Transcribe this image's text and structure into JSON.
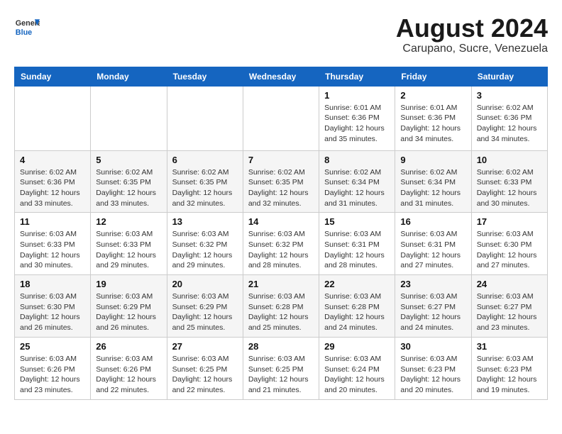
{
  "header": {
    "logo_general": "General",
    "logo_blue": "Blue",
    "main_title": "August 2024",
    "subtitle": "Carupano, Sucre, Venezuela"
  },
  "days_of_week": [
    "Sunday",
    "Monday",
    "Tuesday",
    "Wednesday",
    "Thursday",
    "Friday",
    "Saturday"
  ],
  "weeks": [
    {
      "cells": [
        {
          "day": "",
          "info": ""
        },
        {
          "day": "",
          "info": ""
        },
        {
          "day": "",
          "info": ""
        },
        {
          "day": "",
          "info": ""
        },
        {
          "day": "1",
          "info": "Sunrise: 6:01 AM\nSunset: 6:36 PM\nDaylight: 12 hours\nand 35 minutes."
        },
        {
          "day": "2",
          "info": "Sunrise: 6:01 AM\nSunset: 6:36 PM\nDaylight: 12 hours\nand 34 minutes."
        },
        {
          "day": "3",
          "info": "Sunrise: 6:02 AM\nSunset: 6:36 PM\nDaylight: 12 hours\nand 34 minutes."
        }
      ]
    },
    {
      "cells": [
        {
          "day": "4",
          "info": "Sunrise: 6:02 AM\nSunset: 6:36 PM\nDaylight: 12 hours\nand 33 minutes."
        },
        {
          "day": "5",
          "info": "Sunrise: 6:02 AM\nSunset: 6:35 PM\nDaylight: 12 hours\nand 33 minutes."
        },
        {
          "day": "6",
          "info": "Sunrise: 6:02 AM\nSunset: 6:35 PM\nDaylight: 12 hours\nand 32 minutes."
        },
        {
          "day": "7",
          "info": "Sunrise: 6:02 AM\nSunset: 6:35 PM\nDaylight: 12 hours\nand 32 minutes."
        },
        {
          "day": "8",
          "info": "Sunrise: 6:02 AM\nSunset: 6:34 PM\nDaylight: 12 hours\nand 31 minutes."
        },
        {
          "day": "9",
          "info": "Sunrise: 6:02 AM\nSunset: 6:34 PM\nDaylight: 12 hours\nand 31 minutes."
        },
        {
          "day": "10",
          "info": "Sunrise: 6:02 AM\nSunset: 6:33 PM\nDaylight: 12 hours\nand 30 minutes."
        }
      ]
    },
    {
      "cells": [
        {
          "day": "11",
          "info": "Sunrise: 6:03 AM\nSunset: 6:33 PM\nDaylight: 12 hours\nand 30 minutes."
        },
        {
          "day": "12",
          "info": "Sunrise: 6:03 AM\nSunset: 6:33 PM\nDaylight: 12 hours\nand 29 minutes."
        },
        {
          "day": "13",
          "info": "Sunrise: 6:03 AM\nSunset: 6:32 PM\nDaylight: 12 hours\nand 29 minutes."
        },
        {
          "day": "14",
          "info": "Sunrise: 6:03 AM\nSunset: 6:32 PM\nDaylight: 12 hours\nand 28 minutes."
        },
        {
          "day": "15",
          "info": "Sunrise: 6:03 AM\nSunset: 6:31 PM\nDaylight: 12 hours\nand 28 minutes."
        },
        {
          "day": "16",
          "info": "Sunrise: 6:03 AM\nSunset: 6:31 PM\nDaylight: 12 hours\nand 27 minutes."
        },
        {
          "day": "17",
          "info": "Sunrise: 6:03 AM\nSunset: 6:30 PM\nDaylight: 12 hours\nand 27 minutes."
        }
      ]
    },
    {
      "cells": [
        {
          "day": "18",
          "info": "Sunrise: 6:03 AM\nSunset: 6:30 PM\nDaylight: 12 hours\nand 26 minutes."
        },
        {
          "day": "19",
          "info": "Sunrise: 6:03 AM\nSunset: 6:29 PM\nDaylight: 12 hours\nand 26 minutes."
        },
        {
          "day": "20",
          "info": "Sunrise: 6:03 AM\nSunset: 6:29 PM\nDaylight: 12 hours\nand 25 minutes."
        },
        {
          "day": "21",
          "info": "Sunrise: 6:03 AM\nSunset: 6:28 PM\nDaylight: 12 hours\nand 25 minutes."
        },
        {
          "day": "22",
          "info": "Sunrise: 6:03 AM\nSunset: 6:28 PM\nDaylight: 12 hours\nand 24 minutes."
        },
        {
          "day": "23",
          "info": "Sunrise: 6:03 AM\nSunset: 6:27 PM\nDaylight: 12 hours\nand 24 minutes."
        },
        {
          "day": "24",
          "info": "Sunrise: 6:03 AM\nSunset: 6:27 PM\nDaylight: 12 hours\nand 23 minutes."
        }
      ]
    },
    {
      "cells": [
        {
          "day": "25",
          "info": "Sunrise: 6:03 AM\nSunset: 6:26 PM\nDaylight: 12 hours\nand 23 minutes."
        },
        {
          "day": "26",
          "info": "Sunrise: 6:03 AM\nSunset: 6:26 PM\nDaylight: 12 hours\nand 22 minutes."
        },
        {
          "day": "27",
          "info": "Sunrise: 6:03 AM\nSunset: 6:25 PM\nDaylight: 12 hours\nand 22 minutes."
        },
        {
          "day": "28",
          "info": "Sunrise: 6:03 AM\nSunset: 6:25 PM\nDaylight: 12 hours\nand 21 minutes."
        },
        {
          "day": "29",
          "info": "Sunrise: 6:03 AM\nSunset: 6:24 PM\nDaylight: 12 hours\nand 20 minutes."
        },
        {
          "day": "30",
          "info": "Sunrise: 6:03 AM\nSunset: 6:23 PM\nDaylight: 12 hours\nand 20 minutes."
        },
        {
          "day": "31",
          "info": "Sunrise: 6:03 AM\nSunset: 6:23 PM\nDaylight: 12 hours\nand 19 minutes."
        }
      ]
    }
  ]
}
